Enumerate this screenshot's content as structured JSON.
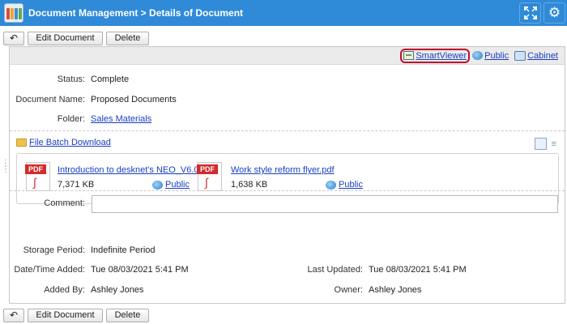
{
  "window": {
    "title": "Document Management > Details of Document"
  },
  "toolbar": {
    "edit_label": "Edit Document",
    "delete_label": "Delete"
  },
  "links": {
    "smartviewer": "SmartViewer",
    "public": "Public",
    "cabinet": "Cabinet"
  },
  "details": {
    "status_label": "Status:",
    "status_value": "Complete",
    "name_label": "Document Name:",
    "name_value": "Proposed Documents",
    "folder_label": "Folder:",
    "folder_value": "Sales Materials"
  },
  "files": {
    "batch_download": "File Batch Download",
    "items": [
      {
        "name": "Introduction to desknet's NEO_V6.0 ...",
        "size": "7,371 KB",
        "visibility": "Public",
        "type_badge": "PDF"
      },
      {
        "name": "Work style reform flyer.pdf",
        "size": "1,638 KB",
        "visibility": "Public",
        "type_badge": "PDF"
      }
    ]
  },
  "meta": {
    "comment_label": "Comment:",
    "comment_value": "",
    "storage_label": "Storage Period:",
    "storage_value": "Indefinite Period",
    "added_label": "Date/Time Added:",
    "added_value": "Tue 08/03/2021 5:41 PM",
    "updated_label": "Last Updated:",
    "updated_value": "Tue 08/03/2021 5:41 PM",
    "added_by_label": "Added By:",
    "added_by_value": "Ashley Jones",
    "owner_label": "Owner:",
    "owner_value": "Ashley Jones"
  },
  "colors": {
    "titlebar": "#2f8ad8",
    "link": "#1a3fbf",
    "highlight": "#c0102a",
    "pdf_red": "#d22b2b"
  },
  "icons": {
    "app": "app-grid-icon",
    "fullscreen": "fullscreen-icon",
    "settings": "gear-icon",
    "back": "back-arrow-icon",
    "smartviewer": "smartviewer-icon",
    "public": "public-globe-icon",
    "cabinet": "cabinet-icon",
    "folder": "folder-icon",
    "pdf": "pdf-file-icon"
  }
}
